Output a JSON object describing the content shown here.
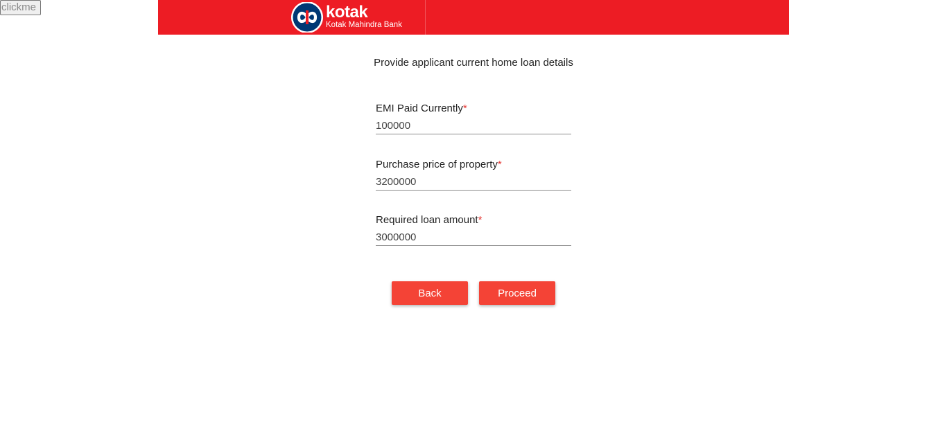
{
  "debug": {
    "clickme_label": "clickme"
  },
  "header": {
    "brand_name": "kotak",
    "brand_subtitle": "Kotak Mahindra Bank",
    "logo_icon": "kotak-infinity-logo-icon",
    "background_color": "#ed1c24"
  },
  "form": {
    "heading": "Provide applicant current home loan details",
    "fields": [
      {
        "label": "EMI Paid Currently",
        "required_mark": "*",
        "value": "100000"
      },
      {
        "label": "Purchase price of property",
        "required_mark": "*",
        "value": "3200000"
      },
      {
        "label": "Required loan amount",
        "required_mark": "*",
        "value": "3000000"
      }
    ]
  },
  "actions": {
    "back_label": "Back",
    "proceed_label": "Proceed",
    "button_color": "#f44336"
  }
}
